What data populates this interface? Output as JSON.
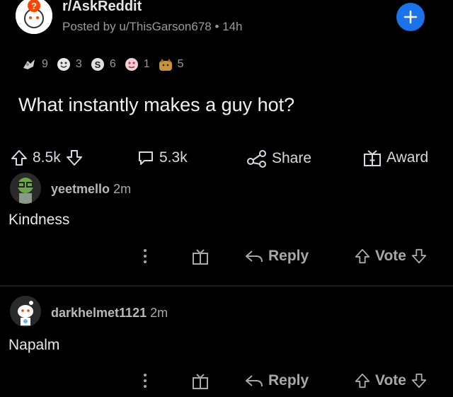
{
  "post": {
    "subreddit": "r/AskReddit",
    "meta": "Posted by u/ThisGarson678 • 14h",
    "title": "What instantly makes a guy hot?",
    "awards": [
      {
        "icon": "silver-award-icon",
        "count": "9"
      },
      {
        "icon": "wholesome-award-icon",
        "count": "3"
      },
      {
        "icon": "s-award-icon",
        "count": "6"
      },
      {
        "icon": "heart-eyes-award-icon",
        "count": "1"
      },
      {
        "icon": "doge-award-icon",
        "count": "5"
      }
    ],
    "score": "8.5k",
    "comments": "5.3k",
    "share": "Share",
    "award": "Award"
  },
  "comments": [
    {
      "author": "yeetmello",
      "time": "2m",
      "body": "Kindness",
      "reply": "Reply",
      "vote": "Vote"
    },
    {
      "author": "darkhelmet1121",
      "time": "2m",
      "body": "Napalm",
      "reply": "Reply",
      "vote": "Vote"
    }
  ],
  "colors": {
    "accent": "#1a73e8",
    "background": "#000000"
  }
}
